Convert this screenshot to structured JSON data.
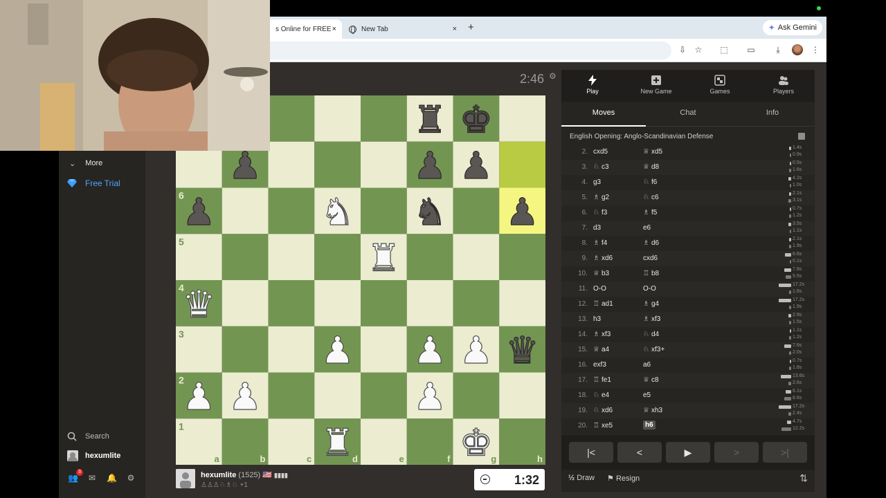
{
  "browser": {
    "tabs": [
      {
        "title": "s Online for FREE -",
        "active": true
      },
      {
        "title": "New Tab",
        "active": false
      }
    ],
    "new_tab": "+",
    "ask_gemini": "Ask Gemini",
    "close_glyph": "×"
  },
  "sidebar": {
    "more": "More",
    "free_trial": "Free Trial",
    "search": "Search",
    "username": "hexumlite",
    "notification_count": "3"
  },
  "board": {
    "top_clock": "2:46",
    "files": [
      "a",
      "b",
      "c",
      "d",
      "e",
      "f",
      "g",
      "h"
    ],
    "ranks_shown": [
      "6",
      "5",
      "4",
      "3",
      "2",
      "1"
    ],
    "light_color": "#ebecd0",
    "dark_color": "#739552",
    "highlight_light": "#f5f682",
    "highlight_dark": "#b9ca43",
    "pieces": [
      {
        "sq": "f8",
        "p": "bR"
      },
      {
        "sq": "g8",
        "p": "bK"
      },
      {
        "sq": "b7",
        "p": "bP"
      },
      {
        "sq": "f7",
        "p": "bP"
      },
      {
        "sq": "g7",
        "p": "bP"
      },
      {
        "sq": "a6",
        "p": "bP"
      },
      {
        "sq": "d6",
        "p": "wN"
      },
      {
        "sq": "f6",
        "p": "bN"
      },
      {
        "sq": "h6",
        "p": "bP"
      },
      {
        "sq": "e5",
        "p": "wR"
      },
      {
        "sq": "a4",
        "p": "wQ"
      },
      {
        "sq": "d3",
        "p": "wP"
      },
      {
        "sq": "f3",
        "p": "wP"
      },
      {
        "sq": "g3",
        "p": "wP"
      },
      {
        "sq": "h3",
        "p": "bQ"
      },
      {
        "sq": "a2",
        "p": "wP"
      },
      {
        "sq": "b2",
        "p": "wP"
      },
      {
        "sq": "f2",
        "p": "wP"
      },
      {
        "sq": "d1",
        "p": "wR"
      },
      {
        "sq": "g1",
        "p": "wK"
      }
    ],
    "highlights": [
      "h7",
      "h6"
    ]
  },
  "bottom_player": {
    "name": "hexumlite",
    "rating": "(1525)",
    "flag": "🇺🇸",
    "captured": "♙♙♙♘♗♘ +1",
    "clock": "1:32"
  },
  "panel": {
    "nav": [
      {
        "label": "Play",
        "icon": "lightning-icon"
      },
      {
        "label": "New Game",
        "icon": "plus-icon"
      },
      {
        "label": "Games",
        "icon": "board-icon"
      },
      {
        "label": "Players",
        "icon": "players-icon"
      }
    ],
    "tabs": [
      "Moves",
      "Chat",
      "Info"
    ],
    "opening": "English Opening: Anglo-Scandinavian Defense",
    "moves": [
      {
        "n": "2.",
        "w": "cxd5",
        "wf": "",
        "b": "xd5",
        "bf": "♕",
        "tw": "1.4s",
        "tb": "0.9s",
        "bw": 3,
        "bb": 2
      },
      {
        "n": "3.",
        "w": "c3",
        "wf": "♘",
        "b": "d8",
        "bf": "♕",
        "tw": "0.5s",
        "tb": "1.6s",
        "bw": 2,
        "bb": 3
      },
      {
        "n": "4.",
        "w": "g3",
        "wf": "",
        "b": "f6",
        "bf": "♘",
        "tw": "4.2s",
        "tb": "1.0s",
        "bw": 4,
        "bb": 2
      },
      {
        "n": "5.",
        "w": "g2",
        "wf": "♗",
        "b": "c6",
        "bf": "♘",
        "tw": "2.1s",
        "tb": "3.1s",
        "bw": 3,
        "bb": 4
      },
      {
        "n": "6.",
        "w": "f3",
        "wf": "♘",
        "b": "f5",
        "bf": "♗",
        "tw": "0.7s",
        "tb": "1.2s",
        "bw": 2,
        "bb": 3
      },
      {
        "n": "7.",
        "w": "d3",
        "wf": "",
        "b": "e6",
        "bf": "",
        "tw": "3.5s",
        "tb": "1.1s",
        "bw": 4,
        "bb": 2
      },
      {
        "n": "8.",
        "w": "f4",
        "wf": "♗",
        "b": "d6",
        "bf": "♗",
        "tw": "2.1s",
        "tb": "1.9s",
        "bw": 3,
        "bb": 3
      },
      {
        "n": "9.",
        "w": "xd6",
        "wf": "♗",
        "b": "cxd6",
        "bf": "",
        "tw": "6.6s",
        "tb": "0.1s",
        "bw": 9,
        "bb": 1
      },
      {
        "n": "10.",
        "w": "b3",
        "wf": "♕",
        "b": "b8",
        "bf": "♖",
        "tw": "7.8s",
        "tb": "5.5s",
        "bw": 10,
        "bb": 8
      },
      {
        "n": "11.",
        "w": "O-O",
        "wf": "",
        "b": "O-O",
        "bf": "",
        "tw": "17.2s",
        "tb": "1.6s",
        "bw": 18,
        "bb": 3
      },
      {
        "n": "12.",
        "w": "ad1",
        "wf": "♖",
        "b": "g4",
        "bf": "♗",
        "tw": "17.2s",
        "tb": "1.9s",
        "bw": 18,
        "bb": 3
      },
      {
        "n": "13.",
        "w": "h3",
        "wf": "",
        "b": "xf3",
        "bf": "♗",
        "tw": "2.9s",
        "tb": "1.5s",
        "bw": 4,
        "bb": 3
      },
      {
        "n": "14.",
        "w": "xf3",
        "wf": "♗",
        "b": "d4",
        "bf": "♘",
        "tw": "1.1s",
        "tb": "1.2s",
        "bw": 2,
        "bb": 3
      },
      {
        "n": "15.",
        "w": "a4",
        "wf": "♕",
        "b": "xf3+",
        "bf": "♘",
        "tw": "7.6s",
        "tb": "2.0s",
        "bw": 10,
        "bb": 3
      },
      {
        "n": "16.",
        "w": "exf3",
        "wf": "",
        "b": "a6",
        "bf": "",
        "tw": "0.7s",
        "tb": "1.8s",
        "bw": 2,
        "bb": 3
      },
      {
        "n": "17.",
        "w": "fe1",
        "wf": "♖",
        "b": "c8",
        "bf": "♕",
        "tw": "13.6s",
        "tb": "2.6s",
        "bw": 15,
        "bb": 4
      },
      {
        "n": "18.",
        "w": "e4",
        "wf": "♘",
        "b": "e5",
        "bf": "",
        "tw": "6.1s",
        "tb": "8.6s",
        "bw": 8,
        "bb": 10
      },
      {
        "n": "19.",
        "w": "xd6",
        "wf": "♘",
        "b": "xh3",
        "bf": "♕",
        "tw": "17.2s",
        "tb": "2.4s",
        "bw": 18,
        "bb": 4
      },
      {
        "n": "20.",
        "w": "xe5",
        "wf": "♖",
        "b": "h6",
        "bf": "",
        "tw": "4.7s",
        "tb": "12.2s",
        "bw": 6,
        "bb": 14
      }
    ],
    "current_move": "h6",
    "actions": {
      "draw": "Draw",
      "draw_prefix": "½",
      "resign": "Resign"
    }
  }
}
